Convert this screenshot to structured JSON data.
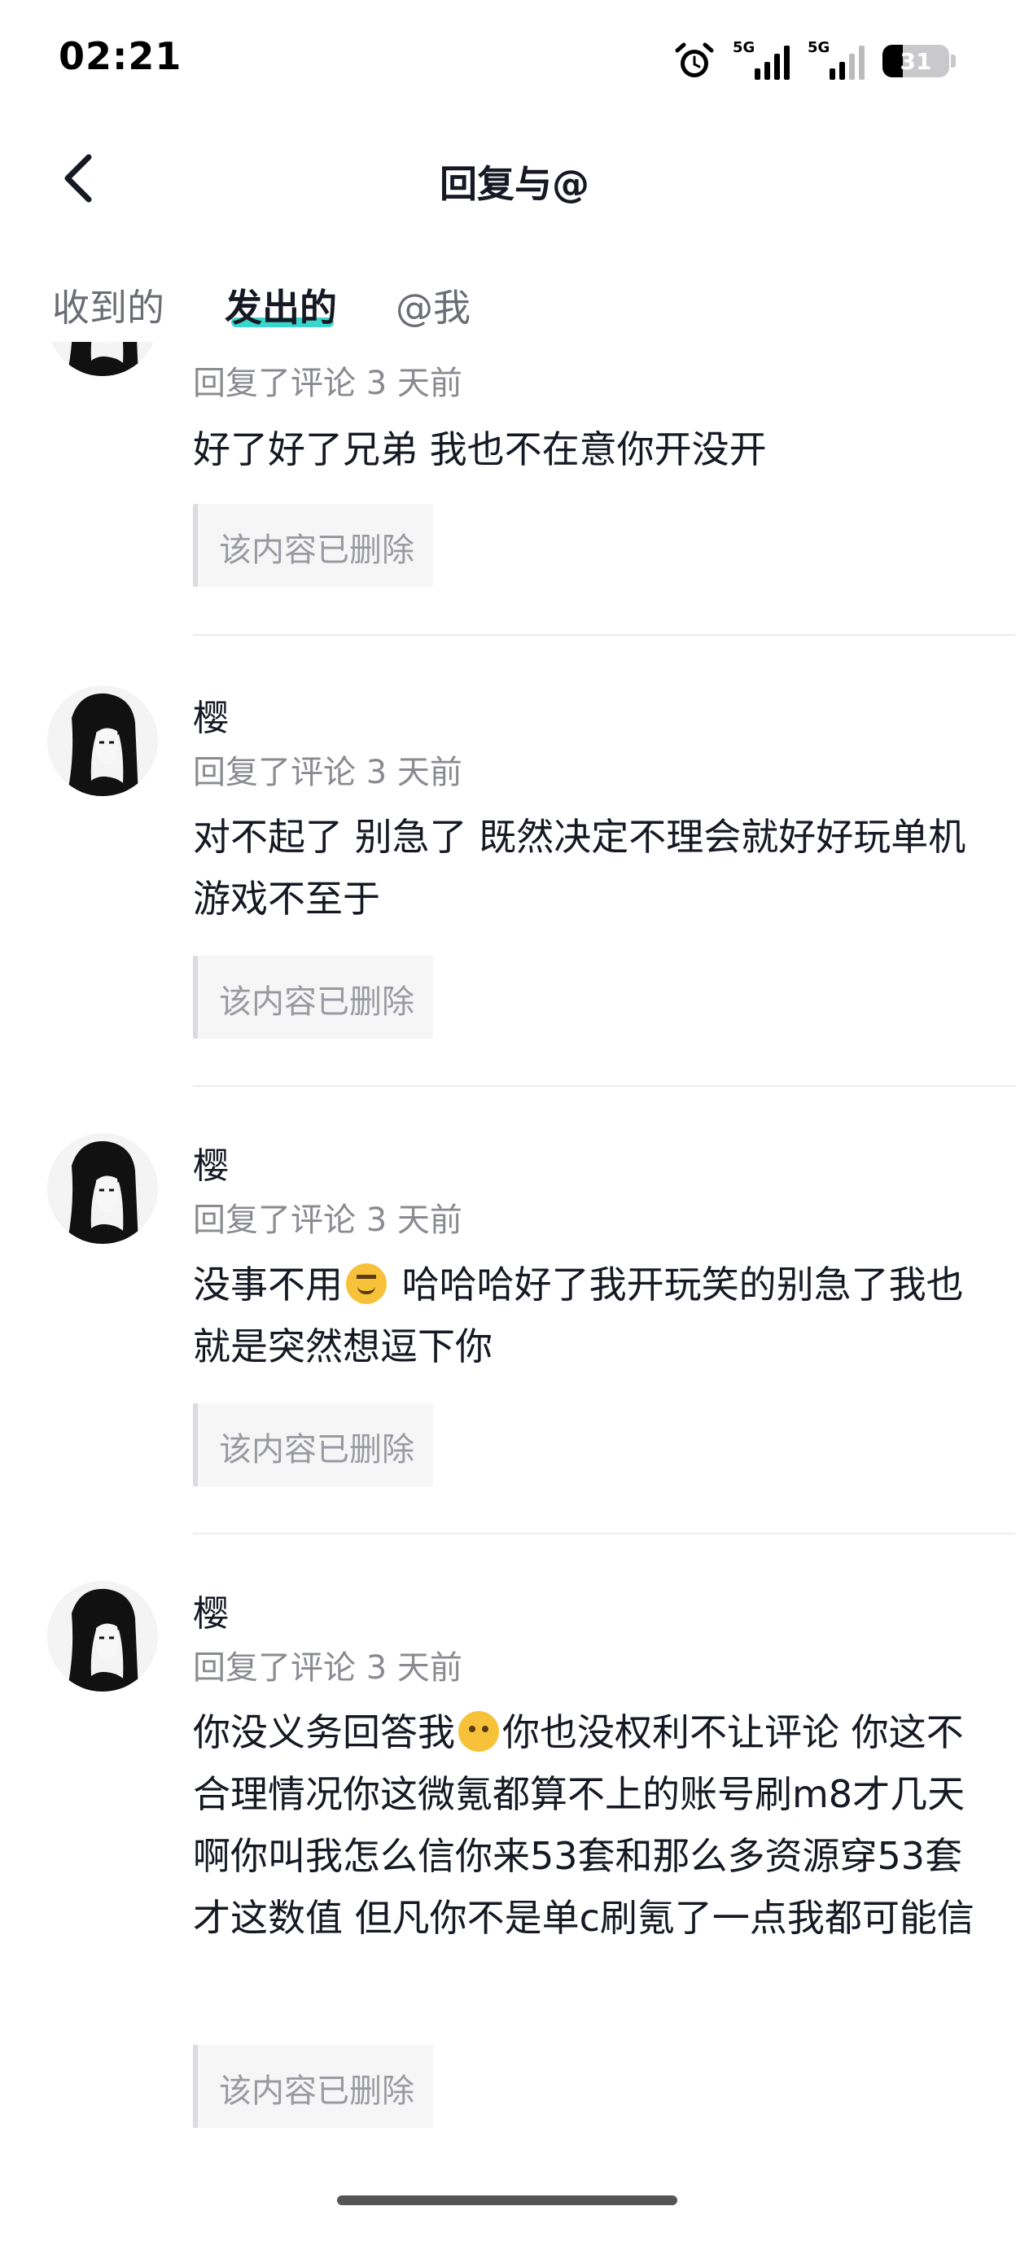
{
  "status_bar": {
    "time": "02:21",
    "network_1": "5G",
    "network_2": "5G",
    "battery": "31",
    "battery_level": 0.31
  },
  "nav": {
    "title": "回复与@",
    "back_icon": "chevron-left-icon"
  },
  "tabs": [
    {
      "label": "收到的",
      "active": false
    },
    {
      "label": "发出的",
      "active": true
    },
    {
      "label": "@我",
      "active": false
    }
  ],
  "accent_color": "#22d2c7",
  "replies": [
    {
      "username": "",
      "meta": "回复了评论 3 天前",
      "text": "好了好了兄弟 我也不在意你开没开",
      "quote": "该内容已删除"
    },
    {
      "username": "樱",
      "meta": "回复了评论 3 天前",
      "text": "对不起了 别急了 既然决定不理会就好好玩单机游戏不至于",
      "quote": "该内容已删除"
    },
    {
      "username": "樱",
      "meta": "回复了评论 3 天前",
      "text_part1": "没事不用",
      "emoji": "smug-face-emoji",
      "text_part2": " 哈哈哈好了我开玩笑的别急了我也就是突然想逗下你",
      "quote": "该内容已删除"
    },
    {
      "username": "樱",
      "meta": "回复了评论 3 天前",
      "text_part1": "你没义务回答我",
      "emoji": "blank-face-emoji",
      "text_part2": "你也没权利不让评论 你这不合理情况你这微氪都算不上的账号刷m8才几天啊你叫我怎么信你来53套和那么多资源穿53套才这数值 但凡你不是单c刷氪了一点我都可能信",
      "quote": "该内容已删除"
    }
  ]
}
